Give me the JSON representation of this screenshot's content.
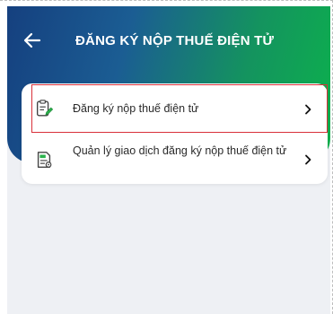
{
  "header": {
    "title": "ĐĂNG KÝ NỘP THUẾ ĐIỆN TỬ",
    "back_icon": "arrow-left-icon"
  },
  "menu": {
    "items": [
      {
        "label": "Đăng ký nộp thuế điện tử",
        "icon": "clipboard-edit-icon",
        "selected": true
      },
      {
        "label": "Quản lý giao dịch đăng ký nộp thuế điện tử",
        "icon": "tax-document-icon",
        "selected": false
      }
    ]
  },
  "colors": {
    "header_gradient_start": "#15407f",
    "header_gradient_end": "#0cb24c",
    "highlight_border": "#d9303a",
    "background": "#eef0f4"
  }
}
